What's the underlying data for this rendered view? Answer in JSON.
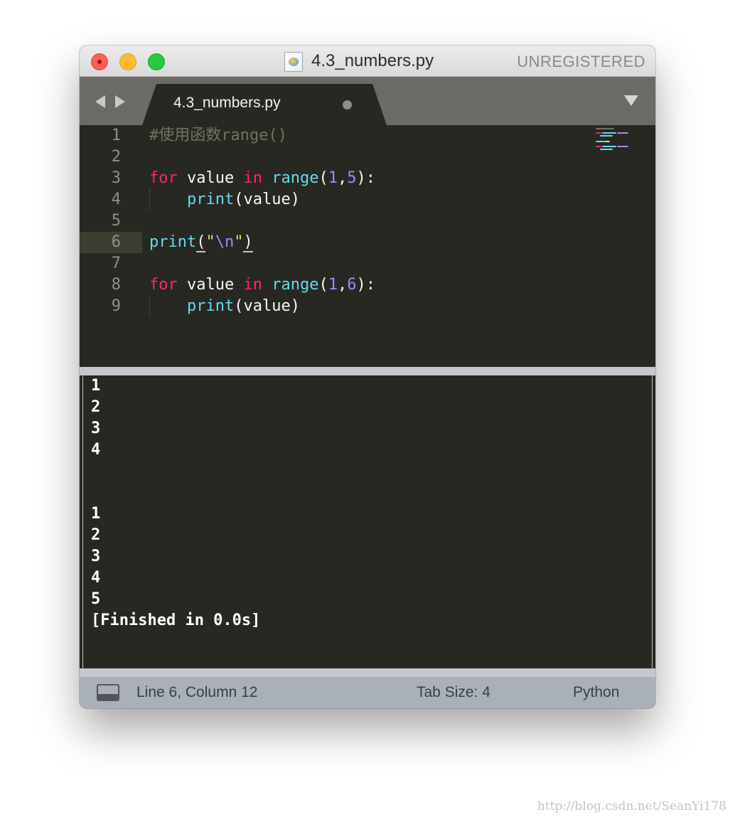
{
  "window": {
    "title": "4.3_numbers.py",
    "unregistered_label": "UNREGISTERED"
  },
  "tabs": [
    {
      "label": "4.3_numbers.py",
      "modified": true
    }
  ],
  "editor": {
    "current_line": 6,
    "line_numbers": [
      "1",
      "2",
      "3",
      "4",
      "5",
      "6",
      "7",
      "8",
      "9"
    ],
    "code": {
      "line1": "#使用函数range()",
      "line3": [
        "for",
        " value ",
        "in",
        " ",
        "range",
        "(",
        "1",
        ",",
        "5",
        "):"
      ],
      "line4": [
        "    ",
        "print",
        "(value)"
      ],
      "line6": [
        "print",
        "(",
        "\"",
        "\\n",
        "\"",
        ")"
      ],
      "line8": [
        "for",
        " value ",
        "in",
        " ",
        "range",
        "(",
        "1",
        ",",
        "6",
        "):"
      ],
      "line9": [
        "    ",
        "print",
        "(value)"
      ]
    }
  },
  "output": {
    "lines": [
      "1",
      "2",
      "3",
      "4",
      "",
      "",
      "1",
      "2",
      "3",
      "4",
      "5",
      "[Finished in 0.0s]"
    ]
  },
  "statusbar": {
    "position": "Line 6, Column 12",
    "tab_size": "Tab Size: 4",
    "syntax": "Python"
  },
  "watermark": "http://blog.csdn.net/SeanYi178",
  "colors": {
    "editor_bg": "#272822",
    "keyword": "#f92672",
    "function": "#66d9ef",
    "number": "#ae81ff",
    "string": "#e6db74",
    "comment": "#75715e",
    "statusbar_bg": "#a9b0b8"
  },
  "icons": {
    "file": "python-file-icon",
    "nav_back": "chevron-left-icon",
    "nav_forward": "chevron-right-icon",
    "tab_menu": "triangle-down-icon",
    "panel": "panel-toggle-icon"
  }
}
